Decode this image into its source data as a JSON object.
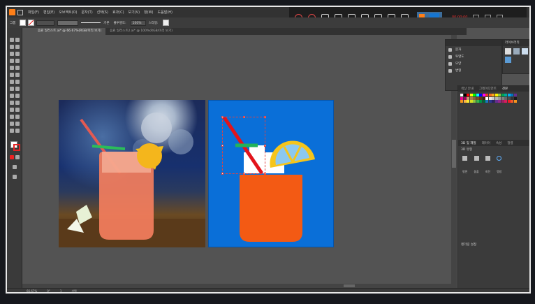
{
  "app": {
    "title": "Illustrator"
  },
  "menu": [
    "파일(F)",
    "편집(E)",
    "오브젝트(O)",
    "문자(T)",
    "선택(S)",
    "효과(C)",
    "보기(V)",
    "창(W)",
    "도움말(H)"
  ],
  "capture_bar": {
    "recording_text": "00:00:00"
  },
  "control_bar": {
    "selection_label": "그룹",
    "stroke_label": "기본",
    "opacity_label": "불투명도:",
    "opacity_value": "100%",
    "style_label": "스타일:"
  },
  "tabs": [
    {
      "label": "음료 일러스트.ai* @ 66.67%(RGB/미리 보기)",
      "active": true
    },
    {
      "label": "음료 일러스트2.ai* @ 100%(RGB/미리 보기)",
      "active": false
    }
  ],
  "float_panel": {
    "items": [
      {
        "label": "문자",
        "icon": "type-icon"
      },
      {
        "label": "투명도",
        "icon": "transparency-icon"
      },
      {
        "label": "모양",
        "icon": "appearance-icon"
      },
      {
        "label": "변형",
        "icon": "transform-icon"
      }
    ]
  },
  "float_panel2": {
    "tab": "라이브러리"
  },
  "swatch_panel": {
    "tabs": [
      "색상 안내",
      "그레이디언트",
      "견본"
    ],
    "active_tab": "견본",
    "colors": [
      "#ffffff",
      "#000000",
      "#ff0000",
      "#ffff00",
      "#00ff00",
      "#00ffff",
      "#0000ff",
      "#ff00ff",
      "#e8352b",
      "#f36c21",
      "#f7a81b",
      "#fff200",
      "#8dc63f",
      "#00a651",
      "#00a99d",
      "#00aeef",
      "#0072bc",
      "#662d91",
      "#ec008c",
      "#9e005d",
      "#c69c6d",
      "#a67c52",
      "#8c6239",
      "#754c24",
      "#603813",
      "#42210b",
      "#ffffff",
      "#e6e6e6",
      "#cccccc",
      "#b3b3b3",
      "#999999",
      "#808080",
      "#666666",
      "#4d4d4d",
      "#333333",
      "#1a1a1a",
      "#f7941d",
      "#fbb040",
      "#f9ed32",
      "#d7df23",
      "#8dc63f",
      "#39b54a",
      "#009444",
      "#006838",
      "#1c75bc",
      "#2b3990",
      "#262262",
      "#662d91",
      "#92278f",
      "#9e1f63",
      "#da1c5c",
      "#ed1c24",
      "#f15a29",
      "#f7941d"
    ]
  },
  "properties_panel": {
    "tabs": [
      "3D 및 재질",
      "레이어",
      "속성",
      "정렬"
    ],
    "section": "3D 유형",
    "types": [
      "평면",
      "돌출",
      "회전",
      "팽창"
    ],
    "footer": "렌더링 설정"
  },
  "status": {
    "zoom": "66.67%",
    "rotation": "0°",
    "artboard": "1",
    "tool": "선택"
  }
}
